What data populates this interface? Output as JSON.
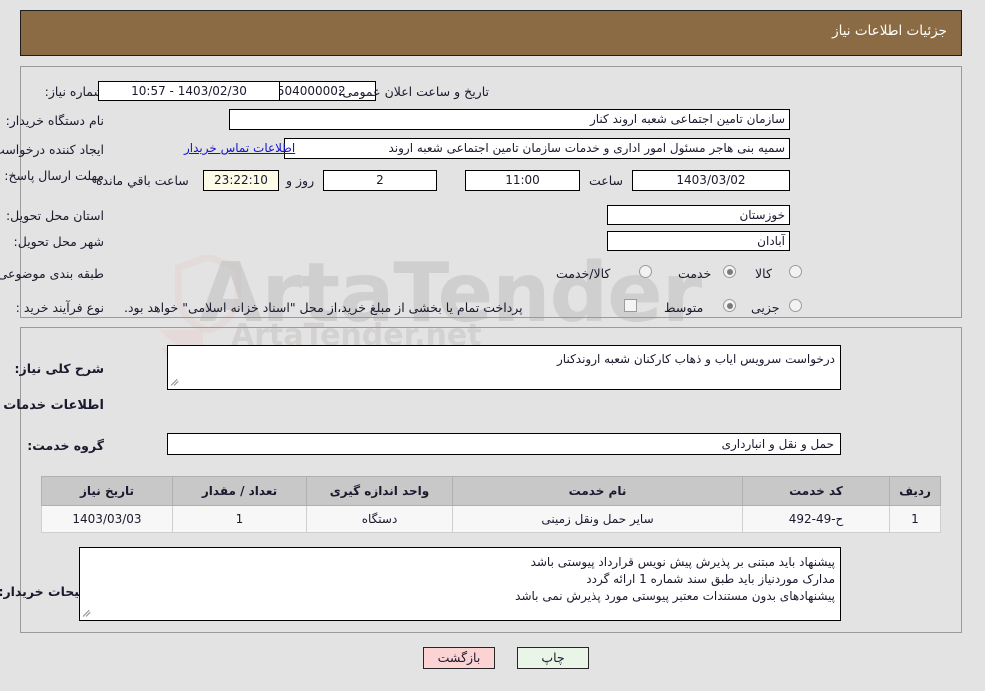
{
  "header": {
    "title": "جزئیات اطلاعات نیاز"
  },
  "form": {
    "need_number_label": "شماره نیاز:",
    "need_number_value": "1103090504000002",
    "announce_label": "تاریخ و ساعت اعلان عمومی:",
    "announce_value": "1403/02/30 - 10:57",
    "buyer_org_label": "نام دستگاه خریدار:",
    "buyer_org_value": "سازمان تامین اجتماعی شعبه اروند کنار",
    "requester_label": "ایجاد کننده درخواست:",
    "requester_value": "سمیه بنی هاجر مسئول امور اداری و خدمات سازمان تامین اجتماعی شعبه اروند",
    "contact_link": "اطلاعات تماس خریدار",
    "deadline_label": "مهلت ارسال پاسخ: تا تاریخ:",
    "deadline_date": "1403/03/02",
    "deadline_hour_label": "ساعت",
    "deadline_hour_value": "11:00",
    "remaining_days_value": "2",
    "remaining_days_label": "روز و",
    "remaining_time_value": "23:22:10",
    "remaining_time_label": "ساعت باقي مانده",
    "province_label": "استان محل تحویل:",
    "province_value": "خوزستان",
    "city_label": "شهر محل تحویل:",
    "city_value": "آبادان",
    "category_label": "طبقه بندی موضوعی:",
    "category_options": [
      "کالا",
      "خدمت",
      "کالا/خدمت"
    ],
    "category_selected": "خدمت",
    "purchase_type_label": "نوع فرآیند خرید :",
    "purchase_type_options": [
      "جزیی",
      "متوسط"
    ],
    "purchase_type_selected": "متوسط",
    "treasury_checkbox_label": "پرداخت تمام یا بخشی از مبلغ خرید،از محل \"اسناد خزانه اسلامی\" خواهد بود.",
    "treasury_checked": false
  },
  "summary": {
    "need_desc_label": "شرح کلی نیاز:",
    "need_desc_value": "درخواست سرویس ایاب و ذهاب کارکنان شعبه اروندکنار",
    "section_title": "اطلاعات خدمات مورد نیاز",
    "service_group_label": "گروه خدمت:",
    "service_group_value": "حمل و نقل و انبارداری"
  },
  "table": {
    "columns": [
      "ردیف",
      "کد خدمت",
      "نام خدمت",
      "واحد اندازه گیری",
      "تعداد / مقدار",
      "تاریخ نیاز"
    ],
    "rows": [
      {
        "row": "1",
        "code": "ح-49-492",
        "name": "سایر حمل ونقل زمینی",
        "unit": "دستگاه",
        "qty": "1",
        "date": "1403/03/03"
      }
    ]
  },
  "notes": {
    "label": "توضیحات خریدار:",
    "lines": [
      "پیشنهاد باید مبتنی بر پذیرش پیش نویس قرارداد پیوستی باشد",
      "مدارک موردنیاز باید طبق سند شماره 1 ارائه گردد",
      "پیشنهادهای بدون مستندات معتبر  پیوستی مورد پذیرش نمی باشد"
    ]
  },
  "footer": {
    "print_label": "چاپ",
    "back_label": "بازگشت"
  },
  "watermark": {
    "brand_top": "ArtaTender.net",
    "brand_main": "ArtaTender"
  },
  "colors": {
    "header_bg": "#8b6b43",
    "page_bg": "#e3e3e3",
    "link": "#1414c8",
    "table_header_bg": "#c8c8c8",
    "print_btn_bg": "#e9f6e7",
    "back_btn_bg": "#fbd3d3",
    "countdown_bg": "#fbfbe7"
  }
}
